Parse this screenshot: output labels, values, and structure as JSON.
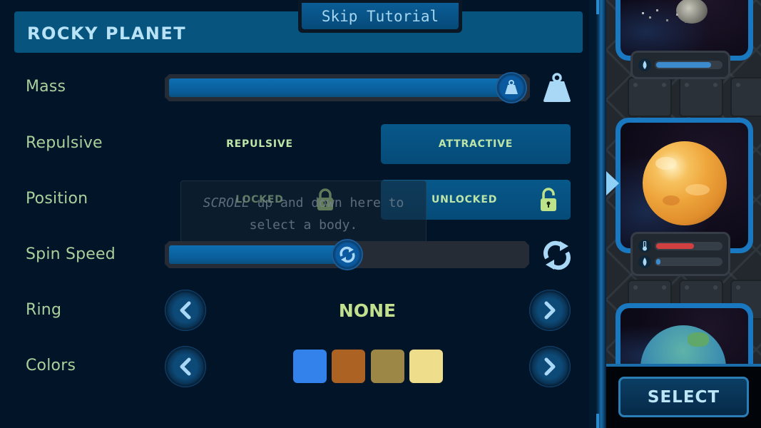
{
  "header": {
    "title": "ROCKY PLANET",
    "skip_tutorial_label": "Skip Tutorial"
  },
  "rows": {
    "mass": {
      "label": "Mass",
      "value_fraction": 0.96,
      "icon": "weight-icon"
    },
    "repulsive": {
      "label": "Repulsive",
      "options": [
        "REPULSIVE",
        "ATTRACTIVE"
      ],
      "selected": "ATTRACTIVE"
    },
    "position": {
      "label": "Position",
      "options": [
        "LOCKED",
        "UNLOCKED"
      ],
      "selected": "UNLOCKED",
      "icons": [
        "lock-closed-icon",
        "lock-open-icon"
      ]
    },
    "spin_speed": {
      "label": "Spin Speed",
      "value_fraction": 0.5,
      "icon": "spin-icon"
    },
    "ring": {
      "label": "Ring",
      "value": "NONE"
    },
    "colors": {
      "label": "Colors",
      "swatches": [
        "#3381ea",
        "#ac6223",
        "#9c8746",
        "#eedd8a"
      ]
    }
  },
  "tooltip": {
    "line1_italic": "SCROLL",
    "line1_rest": " up and down here to",
    "line2": "select a body."
  },
  "picker": {
    "bodies": [
      {
        "name": "asteroid",
        "stats": [
          {
            "icon": "water-drop-icon",
            "fraction": 0.85,
            "color": "#3c8ccd"
          }
        ]
      },
      {
        "name": "rocky-planet",
        "selected": true,
        "stats": [
          {
            "icon": "thermometer-icon",
            "fraction": 0.6,
            "color": "#d04040"
          },
          {
            "icon": "water-drop-icon",
            "fraction": 0.04,
            "color": "#3c8ccd"
          }
        ]
      },
      {
        "name": "earth-like-planet",
        "stats": []
      }
    ],
    "select_label": "SELECT"
  },
  "colors": {
    "accent": "#07547e",
    "label_text": "#aad09c",
    "option_text": "#bde5a8",
    "icon_light": "#a5d6f1",
    "lock_green": "#bde38a"
  }
}
